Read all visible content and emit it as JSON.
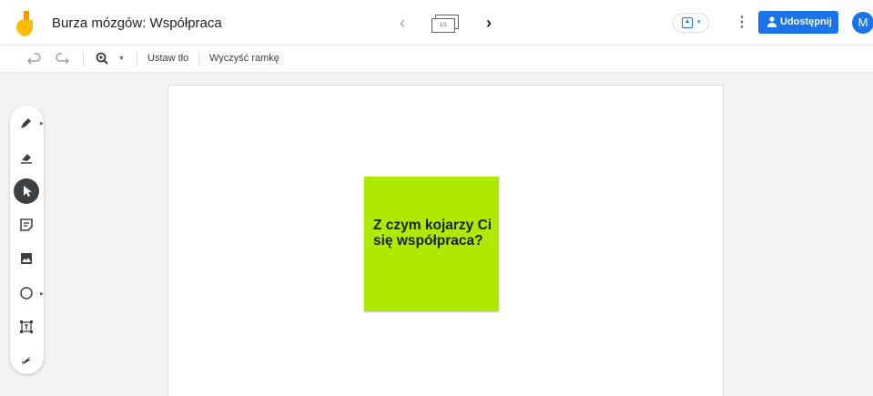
{
  "app": {
    "title": "Burza mózgów: Współpraca",
    "frame_counter": "1/1",
    "share_label": "Udostępnij",
    "avatar_initial": "M"
  },
  "toolbar": {
    "set_background_label": "Ustaw tło",
    "clear_frame_label": "Wyczyść ramkę"
  },
  "sticky_note": {
    "text": "Z czym kojarzy Ci się współpraca?",
    "color": "#aeea00"
  },
  "tools": [
    {
      "name": "pen-icon",
      "active": false
    },
    {
      "name": "eraser-icon",
      "active": false
    },
    {
      "name": "select-icon",
      "active": true
    },
    {
      "name": "sticky-note-icon",
      "active": false
    },
    {
      "name": "image-icon",
      "active": false
    },
    {
      "name": "circle-icon",
      "active": false
    },
    {
      "name": "text-box-icon",
      "active": false
    },
    {
      "name": "laser-icon",
      "active": false
    }
  ],
  "colors": {
    "accent": "#1a73e8",
    "sticky": "#aeea00",
    "active_tool": "#3c4043"
  }
}
